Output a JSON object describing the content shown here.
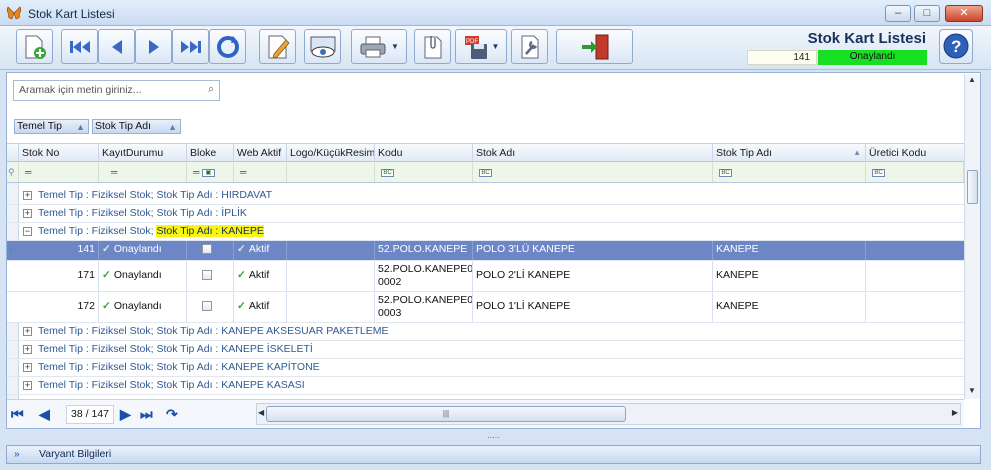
{
  "window": {
    "title": "Stok Kart Listesi",
    "controls": [
      "minimize",
      "maximize",
      "close"
    ]
  },
  "header": {
    "title": "Stok Kart Listesi",
    "count": "141",
    "status": "Onaylandı",
    "status_color": "#17e024"
  },
  "search": {
    "placeholder": "Aramak için metin giriniz..."
  },
  "group_by": [
    {
      "label": "Temel Tip"
    },
    {
      "label": "Stok Tip Adı"
    }
  ],
  "columns": [
    "Stok No",
    "KayıtDurumu",
    "Bloke",
    "Web Aktif",
    "Logo/KüçükResim",
    "Kodu",
    "Stok Adı",
    "Stok Tip Adı",
    "Üretici Kodu"
  ],
  "groups_before": [
    "Temel Tip : Fiziksel Stok;  Stok Tip Adı : HIRDAVAT",
    "Temel Tip : Fiziksel Stok;  Stok Tip Adı : İPLİK"
  ],
  "expanded_group": {
    "prefix": "Temel Tip : Fiziksel Stok;  ",
    "highlight": "Stok Tip Adı : KANEPE"
  },
  "rows": [
    {
      "stok_no": "141",
      "durum": "Onaylandı",
      "web": "Aktif",
      "kodu": "52.POLO.KANEPE",
      "kodu2": "",
      "stok_adi": "POLO 3'LÜ KANEPE",
      "tip": "KANEPE"
    },
    {
      "stok_no": "171",
      "durum": "Onaylandı",
      "web": "Aktif",
      "kodu": "52.POLO.KANEPE0",
      "kodu2": "0002",
      "stok_adi": "POLO 2'Lİ KANEPE",
      "tip": "KANEPE"
    },
    {
      "stok_no": "172",
      "durum": "Onaylandı",
      "web": "Aktif",
      "kodu": "52.POLO.KANEPE0",
      "kodu2": "0003",
      "stok_adi": "POLO 1'Lİ KANEPE",
      "tip": "KANEPE"
    }
  ],
  "groups_after": [
    "Temel Tip : Fiziksel Stok;  Stok Tip Adı : KANEPE AKSESUAR PAKETLEME",
    "Temel Tip : Fiziksel Stok;  Stok Tip Adı : KANEPE İSKELETİ",
    "Temel Tip : Fiziksel Stok;  Stok Tip Adı : KANEPE KAPİTONE",
    "Temel Tip : Fiziksel Stok;  Stok Tip Adı : KANEPE KASASI"
  ],
  "filter_icon_text": "BC",
  "pager": {
    "text": "38 / 147"
  },
  "hscroll_grip": "|||",
  "splitter_grip": ".....",
  "bottom_panel": {
    "label": "Varyant Bilgileri"
  }
}
